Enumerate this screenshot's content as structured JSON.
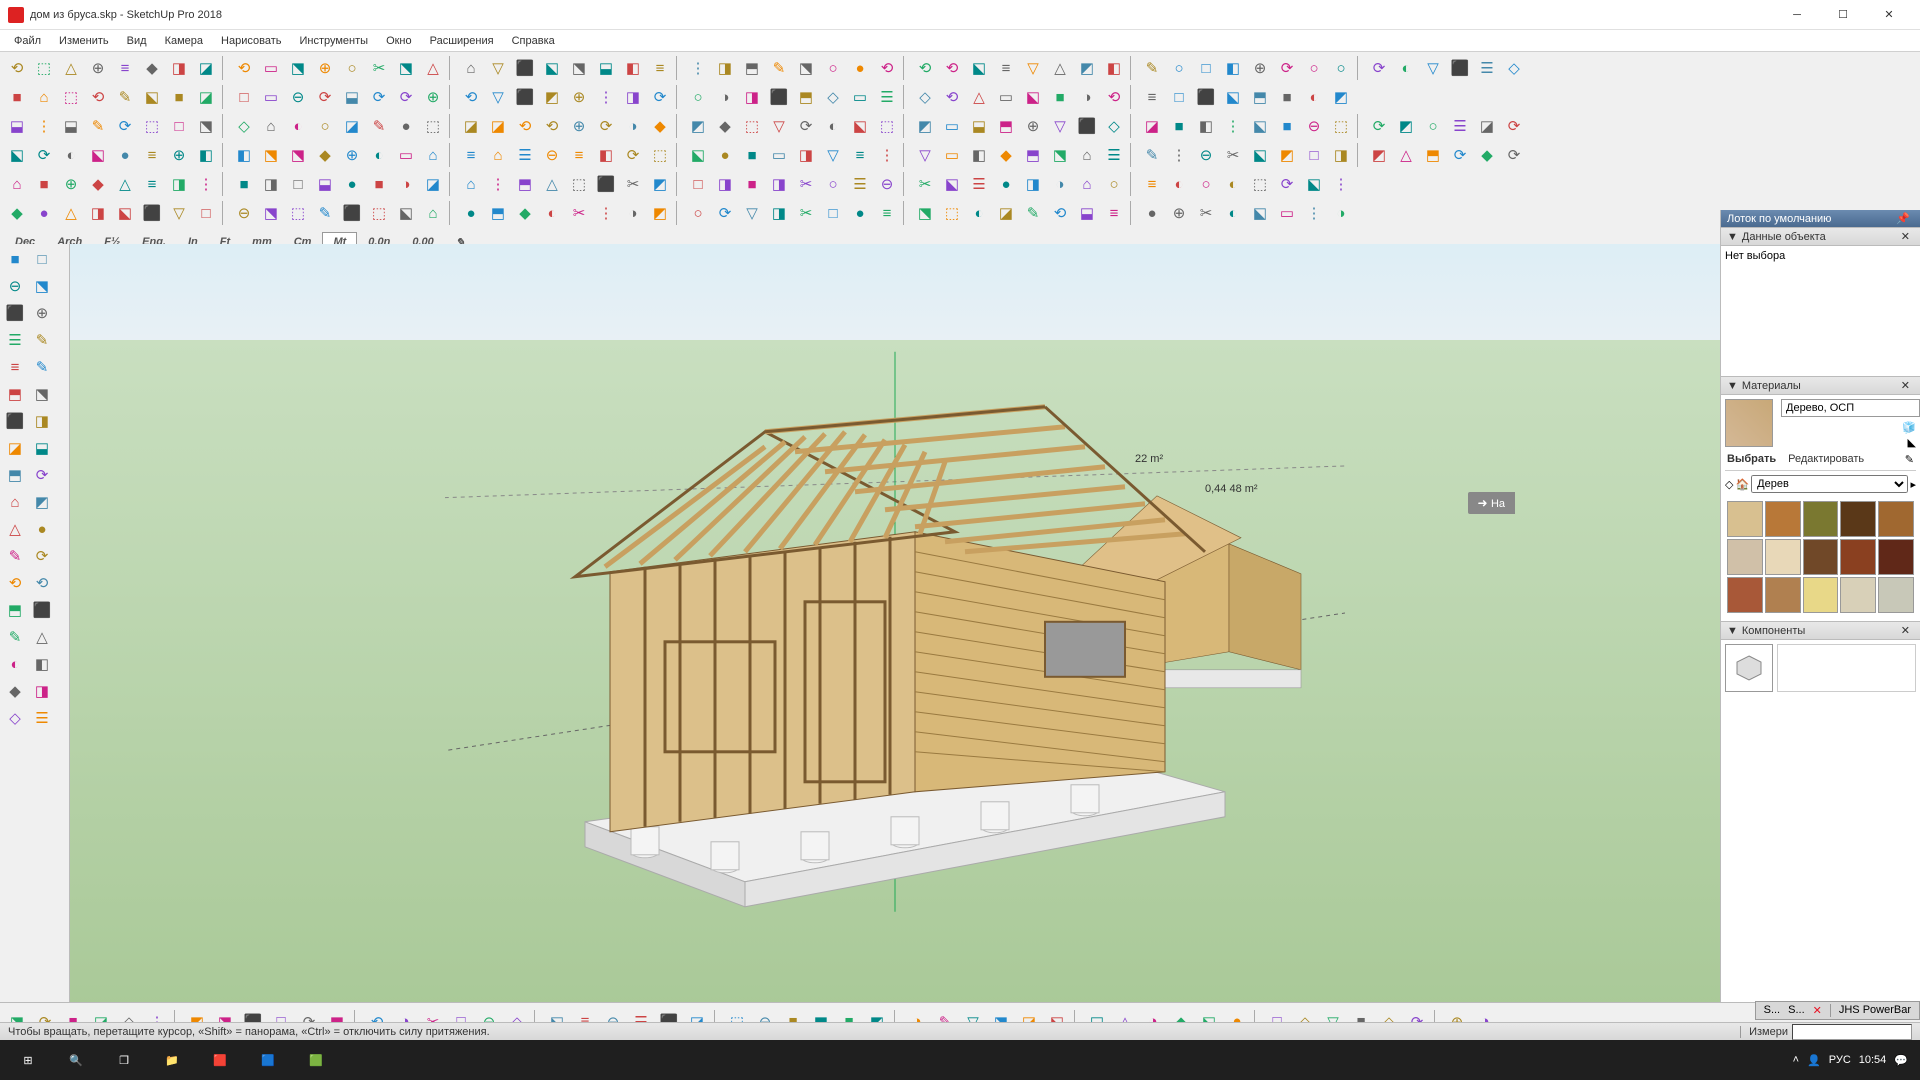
{
  "title": "дом из бруса.skp - SketchUp Pro 2018",
  "menu": [
    "Файл",
    "Изменить",
    "Вид",
    "Камера",
    "Нарисовать",
    "Инструменты",
    "Окно",
    "Расширения",
    "Справка"
  ],
  "units": [
    "Dec",
    "Arch",
    "F½",
    "Eng.",
    "In",
    "Ft",
    "mm",
    "Cm",
    "Mt",
    "0.0n",
    "0.00"
  ],
  "active_unit": "Mt",
  "tray": {
    "title": "Лоток по умолчанию"
  },
  "panels": {
    "entity": {
      "title": "Данные объекта",
      "body": "Нет выбора"
    },
    "materials": {
      "title": "Материалы",
      "name": "Дерево, ОСП",
      "tab_select": "Выбрать",
      "tab_edit": "Редактировать",
      "category": "Дерев"
    },
    "components": {
      "title": "Компоненты"
    }
  },
  "status": "Чтобы вращать, перетащите курсор, «Shift» = панорама, «Ctrl» = отключить силу притяжения.",
  "measure_label": "Измери",
  "swatches": [
    "#d8c090",
    "#b87838",
    "#7a7830",
    "#5a3818",
    "#a06830",
    "#d0c0a8",
    "#e8d8b8",
    "#704828",
    "#8a4020",
    "#602818",
    "#a85838",
    "#b08050",
    "#e8d888",
    "#d8d0b8",
    "#c8c8b8"
  ],
  "powerbar": "JHS PowerBar",
  "tray_badges": [
    "S...",
    "S..."
  ],
  "tray_time": "10:54",
  "tray_lang": "РУС",
  "hint_badge": "На"
}
